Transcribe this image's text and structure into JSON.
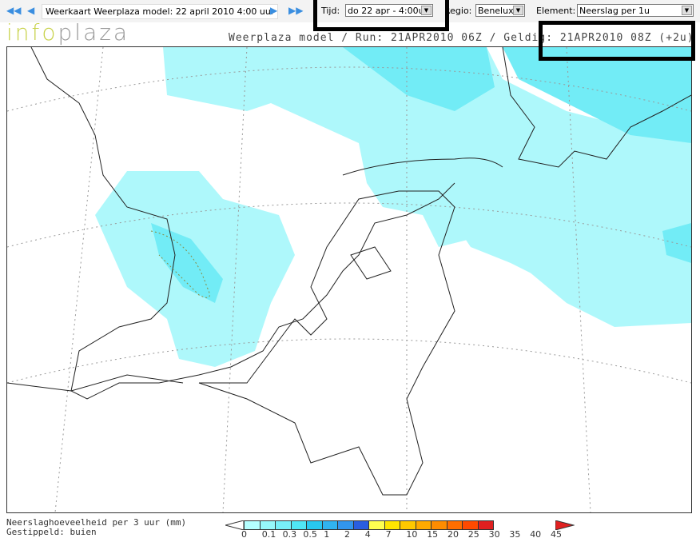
{
  "toolbar": {
    "title": "Weerkaart Weerplaza model: 22 april 2010 4:00 uur",
    "tijd_label": "Tijd:",
    "tijd_value": "do 22 apr - 4:00u",
    "regio_label": "Regio:",
    "regio_value": "Benelux",
    "element_label": "Element:",
    "element_value": "Neerslag per 1u"
  },
  "logo": {
    "part1": "info",
    "part2": "plaza"
  },
  "run_line": "Weerplaza model / Run: 21APR2010 06Z / Geldig: 21APR2010 08Z (+2u)",
  "legend": {
    "line1": "Neerslaghoeveelheid per 3 uur (mm)",
    "line2": "Gestippeld: buien",
    "ticks": [
      "0",
      "0.1",
      "0.3",
      "0.5",
      "1",
      "2",
      "4",
      "7",
      "10",
      "15",
      "20",
      "25",
      "30",
      "35",
      "40",
      "45"
    ],
    "colors": [
      "#b4ffff",
      "#96f8fa",
      "#78f0f8",
      "#50e6f5",
      "#28c8f0",
      "#30b4f0",
      "#3296ee",
      "#2a5ee0",
      "#ffff50",
      "#ffe600",
      "#ffc800",
      "#ffaa00",
      "#ff8c00",
      "#ff6e00",
      "#ff4a00",
      "#e02020"
    ]
  }
}
